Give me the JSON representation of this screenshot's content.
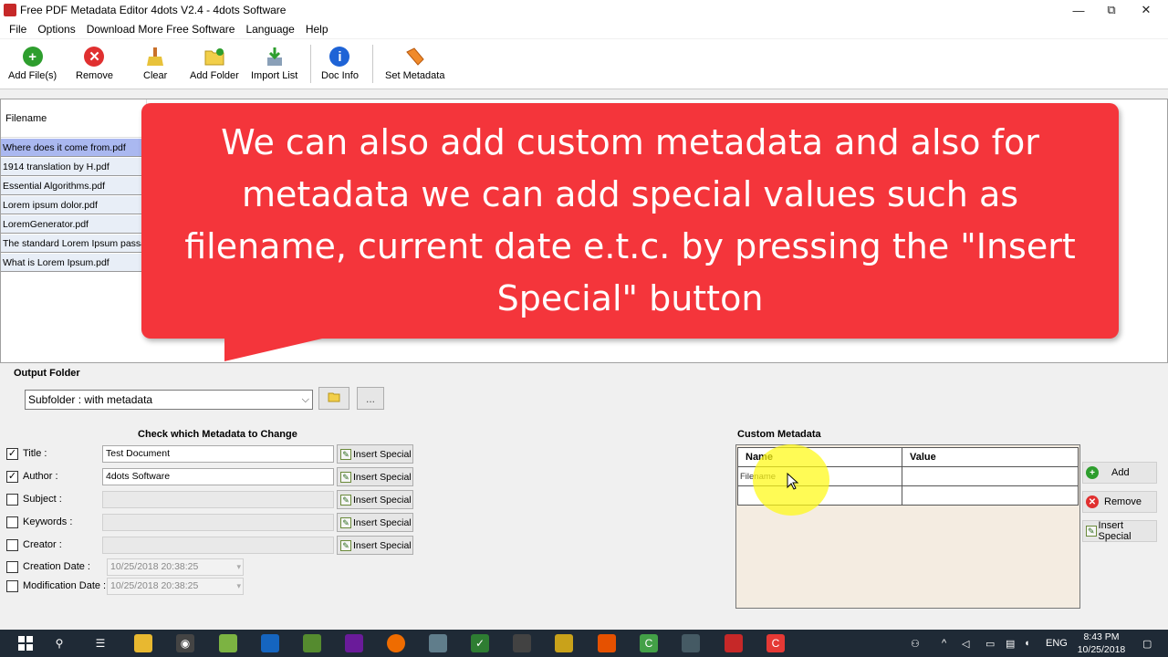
{
  "window": {
    "title": "Free PDF Metadata Editor 4dots V2.4 - 4dots Software",
    "controls": {
      "minimize": "—",
      "restore": "⧉",
      "close": "✕"
    }
  },
  "menu": [
    "File",
    "Options",
    "Download More Free Software",
    "Language",
    "Help"
  ],
  "toolbar": {
    "add_files": "Add File(s)",
    "remove": "Remove",
    "clear": "Clear",
    "add_folder": "Add Folder",
    "import_list": "Import List",
    "doc_info": "Doc Info",
    "set_metadata": "Set Metadata"
  },
  "file_list": {
    "header": "Filename",
    "files": [
      "Where does it come from.pdf",
      "1914 translation by H.pdf",
      "Essential Algorithms.pdf",
      "Lorem ipsum dolor.pdf",
      "LoremGenerator.pdf",
      "The standard Lorem Ipsum passage",
      "What is Lorem Ipsum.pdf"
    ]
  },
  "callout": {
    "text": "We can also add custom metadata and also for metadata we can add special values such as filename, current date e.t.c. by pressing the \"Insert Special\" button"
  },
  "output_folder": {
    "label": "Output Folder",
    "value": "Subfolder : with metadata",
    "browse_more": "..."
  },
  "metadata": {
    "heading": "Check which Metadata to Change",
    "insert_special": "Insert Special",
    "fields": [
      {
        "label": "Title :",
        "value": "Test Document",
        "checked": true
      },
      {
        "label": "Author :",
        "value": "4dots Software",
        "checked": true
      },
      {
        "label": "Subject :",
        "value": "",
        "checked": false
      },
      {
        "label": "Keywords :",
        "value": "",
        "checked": false
      },
      {
        "label": "Creator :",
        "value": "",
        "checked": false
      }
    ],
    "dates": [
      {
        "label": "Creation Date :",
        "value": "10/25/2018 20:38:25",
        "checked": false
      },
      {
        "label": "Modification Date :",
        "value": "10/25/2018 20:38:25",
        "checked": false
      }
    ]
  },
  "custom_metadata": {
    "label": "Custom Metadata",
    "col_name": "Name",
    "col_value": "Value",
    "row1_name": "Filename",
    "add": "Add",
    "remove": "Remove",
    "insert_special": "Insert Special"
  },
  "taskbar": {
    "lang": "ENG",
    "time": "8:43 PM",
    "date": "10/25/2018"
  },
  "colors": {
    "callout": "#f4353b",
    "selection": "#aab8f0",
    "highlight": "#fffa14"
  }
}
